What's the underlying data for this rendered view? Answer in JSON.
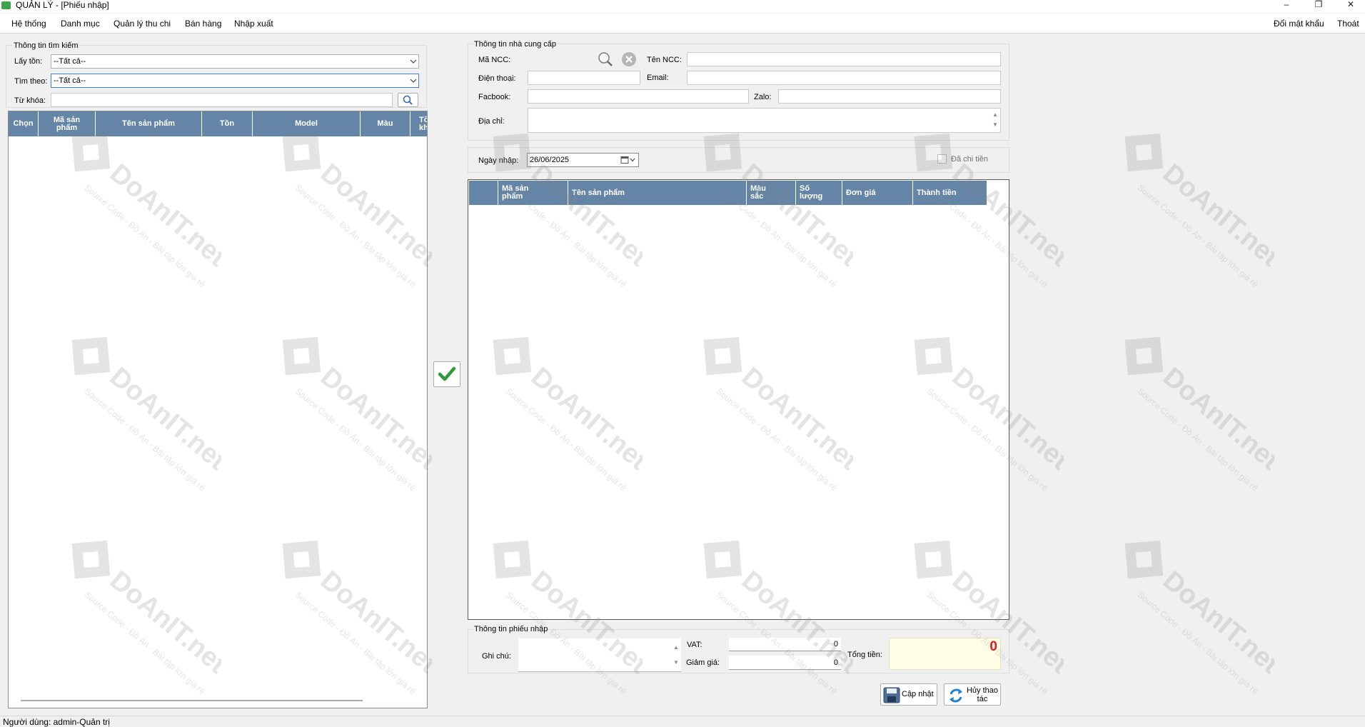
{
  "window": {
    "title": "QUẢN LÝ - [Phiếu nhập]",
    "minimize": "–",
    "restore": "❐",
    "close": "✕"
  },
  "menu": {
    "left": [
      "Hệ thống",
      "Danh mục",
      "Quản lý thu chi",
      "Bán hàng",
      "Nhập xuất"
    ],
    "right": [
      "Đổi mật khẩu",
      "Thoát"
    ]
  },
  "search": {
    "group": "Thông tin tìm kiếm",
    "lay_ton_label": "Lấy tồn:",
    "lay_ton_value": "--Tất cả--",
    "tim_theo_label": "Tìm theo:",
    "tim_theo_value": "--Tất cả--",
    "tu_khoa_label": "Từ khóa:",
    "tu_khoa_value": ""
  },
  "product_grid": {
    "columns": [
      "Chọn",
      "Mã sản phẩm",
      "Tên sản phẩm",
      "Tồn",
      "Model",
      "Màu",
      "Tồn kho"
    ]
  },
  "supplier": {
    "group": "Thông tin nhà cung cấp",
    "ma_ncc_label": "Mã NCC:",
    "ma_ncc_value": "",
    "ten_ncc_label": "Tên NCC:",
    "ten_ncc_value": "",
    "dien_thoai_label": "Điện thoại:",
    "dien_thoai_value": "",
    "email_label": "Email:",
    "email_value": "",
    "facebook_label": "Facbook:",
    "facebook_value": "",
    "zalo_label": "Zalo:",
    "zalo_value": "",
    "dia_chi_label": "Địa chỉ:",
    "dia_chi_value": ""
  },
  "import": {
    "ngay_nhap_label": "Ngày nhập:",
    "ngay_nhap_value": "26/06/2025",
    "da_chi_tien_label": "Đã chi tiền",
    "da_chi_tien_checked": false
  },
  "detail_grid": {
    "columns": [
      "Mã sản phẩm",
      "Tên sản phẩm",
      "Màu sắc",
      "Số lượng",
      "Đơn giá",
      "Thành tiền"
    ]
  },
  "receipt": {
    "group": "Thông tin phiếu nhập",
    "ghi_chu_label": "Ghi chú:",
    "ghi_chu_value": "",
    "vat_label": "VAT:",
    "vat_value": "0",
    "giam_gia_label": "Giảm giá:",
    "giam_gia_value": "0",
    "tong_tien_label": "Tổng tiền:",
    "tong_tien_value": "0"
  },
  "buttons": {
    "cap_nhat": "Cập nhật",
    "huy_line1": "Hủy thao",
    "huy_line2": "tác"
  },
  "status": {
    "user": "Người dùng: admin-Quản trị"
  },
  "watermark": {
    "brand": "DoAnIT.net",
    "sub": "Source Code - Đồ Án - Bài tập lớn giá rẻ"
  },
  "colors": {
    "grid_header": "#6585a6",
    "total_bg": "#fffde6",
    "total_value": "#e8141c",
    "check_icon": "#2e9b3c"
  }
}
